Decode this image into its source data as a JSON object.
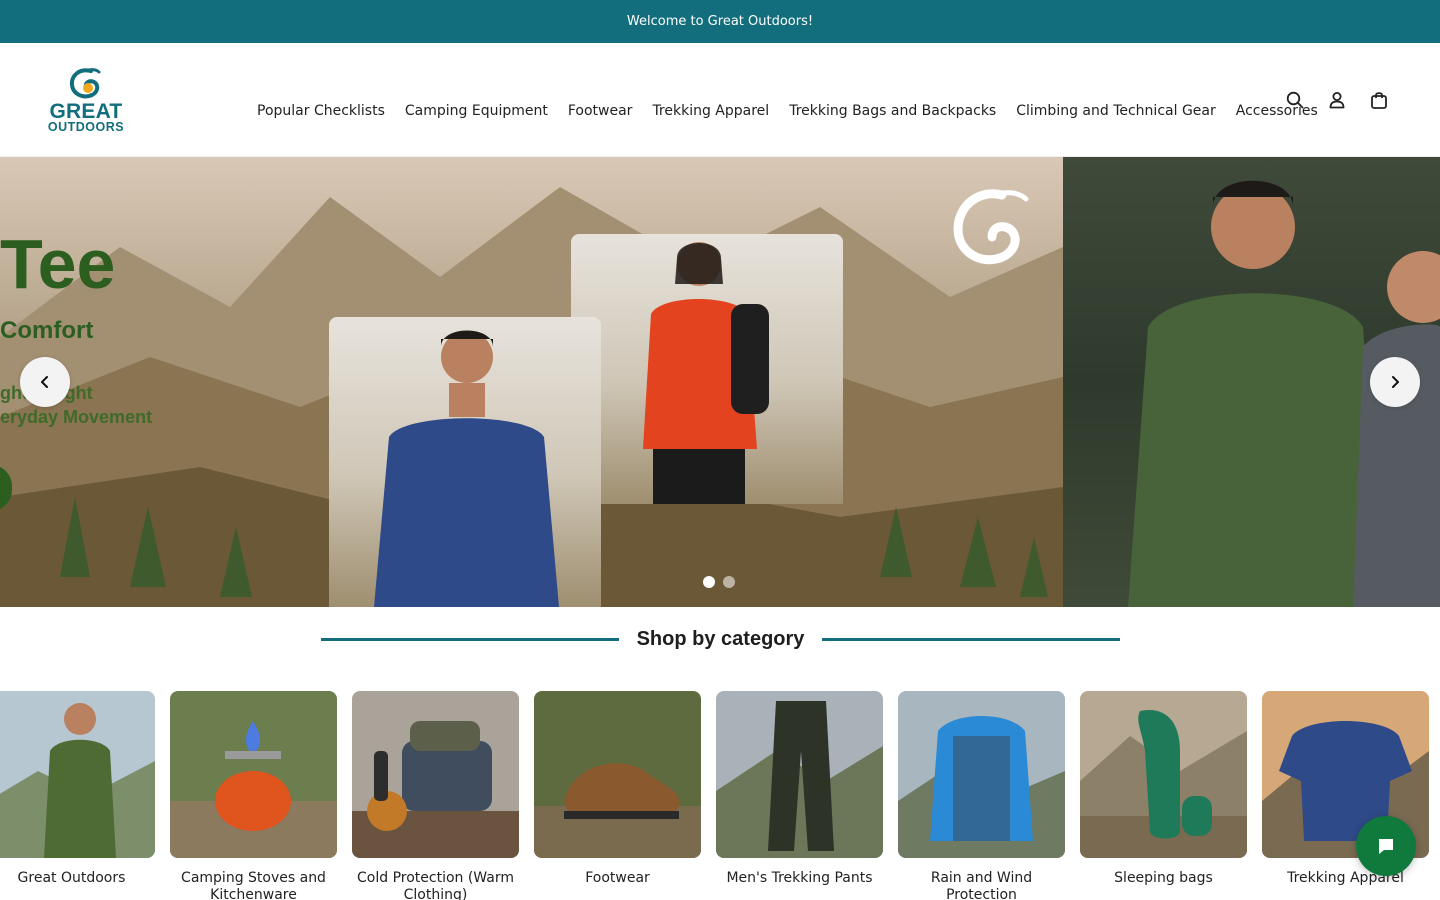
{
  "announcement": {
    "text": "Welcome to Great Outdoors!"
  },
  "brand": {
    "line1": "GREAT",
    "line2": "OUTDOORS",
    "primary_color": "#126e7c",
    "accent_color": "#f2a81d"
  },
  "nav": {
    "items": [
      {
        "label": "Popular Checklists"
      },
      {
        "label": "Camping Equipment"
      },
      {
        "label": "Footwear"
      },
      {
        "label": "Trekking Apparel"
      },
      {
        "label": "Trekking Bags and Backpacks"
      },
      {
        "label": "Climbing and Technical Gear"
      },
      {
        "label": "Accessories"
      }
    ]
  },
  "header_icons": [
    "search-icon",
    "account-icon",
    "cart-icon"
  ],
  "hero": {
    "title": "Tee",
    "subtitle": "Comfort",
    "line1": "ght Weight",
    "line2": "eryday Movement",
    "slide_count": 2,
    "active_slide": 1,
    "text_color": "#2c5e20"
  },
  "categories": {
    "title": "Shop by category",
    "items": [
      {
        "label": "Great Outdoors"
      },
      {
        "label": "Camping Stoves and Kitchenware"
      },
      {
        "label": "Cold Protection (Warm Clothing)"
      },
      {
        "label": "Footwear"
      },
      {
        "label": "Men's Trekking Pants"
      },
      {
        "label": "Rain and Wind Protection"
      },
      {
        "label": "Sleeping bags"
      },
      {
        "label": "Trekking Apparel"
      }
    ]
  },
  "chat": {
    "icon": "chat-bubble-icon",
    "color": "#0f7a3b"
  }
}
